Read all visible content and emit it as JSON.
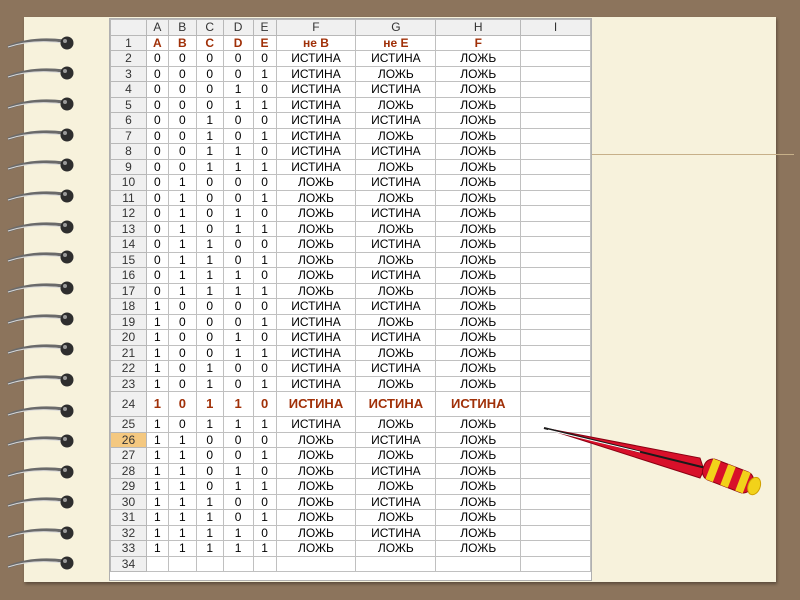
{
  "columns": [
    "",
    "A",
    "B",
    "C",
    "D",
    "E",
    "F",
    "G",
    "H",
    "I"
  ],
  "active_row": "26",
  "highlight_row": "24",
  "header_row": "1",
  "rows": [
    [
      "1",
      "A",
      "B",
      "C",
      "D",
      "E",
      "не В",
      "не Е",
      "F",
      ""
    ],
    [
      "2",
      "0",
      "0",
      "0",
      "0",
      "0",
      "ИСТИНА",
      "ИСТИНА",
      "ЛОЖЬ",
      ""
    ],
    [
      "3",
      "0",
      "0",
      "0",
      "0",
      "1",
      "ИСТИНА",
      "ЛОЖЬ",
      "ЛОЖЬ",
      ""
    ],
    [
      "4",
      "0",
      "0",
      "0",
      "1",
      "0",
      "ИСТИНА",
      "ИСТИНА",
      "ЛОЖЬ",
      ""
    ],
    [
      "5",
      "0",
      "0",
      "0",
      "1",
      "1",
      "ИСТИНА",
      "ЛОЖЬ",
      "ЛОЖЬ",
      ""
    ],
    [
      "6",
      "0",
      "0",
      "1",
      "0",
      "0",
      "ИСТИНА",
      "ИСТИНА",
      "ЛОЖЬ",
      ""
    ],
    [
      "7",
      "0",
      "0",
      "1",
      "0",
      "1",
      "ИСТИНА",
      "ЛОЖЬ",
      "ЛОЖЬ",
      ""
    ],
    [
      "8",
      "0",
      "0",
      "1",
      "1",
      "0",
      "ИСТИНА",
      "ИСТИНА",
      "ЛОЖЬ",
      ""
    ],
    [
      "9",
      "0",
      "0",
      "1",
      "1",
      "1",
      "ИСТИНА",
      "ЛОЖЬ",
      "ЛОЖЬ",
      ""
    ],
    [
      "10",
      "0",
      "1",
      "0",
      "0",
      "0",
      "ЛОЖЬ",
      "ИСТИНА",
      "ЛОЖЬ",
      ""
    ],
    [
      "11",
      "0",
      "1",
      "0",
      "0",
      "1",
      "ЛОЖЬ",
      "ЛОЖЬ",
      "ЛОЖЬ",
      ""
    ],
    [
      "12",
      "0",
      "1",
      "0",
      "1",
      "0",
      "ЛОЖЬ",
      "ИСТИНА",
      "ЛОЖЬ",
      ""
    ],
    [
      "13",
      "0",
      "1",
      "0",
      "1",
      "1",
      "ЛОЖЬ",
      "ЛОЖЬ",
      "ЛОЖЬ",
      ""
    ],
    [
      "14",
      "0",
      "1",
      "1",
      "0",
      "0",
      "ЛОЖЬ",
      "ИСТИНА",
      "ЛОЖЬ",
      ""
    ],
    [
      "15",
      "0",
      "1",
      "1",
      "0",
      "1",
      "ЛОЖЬ",
      "ЛОЖЬ",
      "ЛОЖЬ",
      ""
    ],
    [
      "16",
      "0",
      "1",
      "1",
      "1",
      "0",
      "ЛОЖЬ",
      "ИСТИНА",
      "ЛОЖЬ",
      ""
    ],
    [
      "17",
      "0",
      "1",
      "1",
      "1",
      "1",
      "ЛОЖЬ",
      "ЛОЖЬ",
      "ЛОЖЬ",
      ""
    ],
    [
      "18",
      "1",
      "0",
      "0",
      "0",
      "0",
      "ИСТИНА",
      "ИСТИНА",
      "ЛОЖЬ",
      ""
    ],
    [
      "19",
      "1",
      "0",
      "0",
      "0",
      "1",
      "ИСТИНА",
      "ЛОЖЬ",
      "ЛОЖЬ",
      ""
    ],
    [
      "20",
      "1",
      "0",
      "0",
      "1",
      "0",
      "ИСТИНА",
      "ИСТИНА",
      "ЛОЖЬ",
      ""
    ],
    [
      "21",
      "1",
      "0",
      "0",
      "1",
      "1",
      "ИСТИНА",
      "ЛОЖЬ",
      "ЛОЖЬ",
      ""
    ],
    [
      "22",
      "1",
      "0",
      "1",
      "0",
      "0",
      "ИСТИНА",
      "ИСТИНА",
      "ЛОЖЬ",
      ""
    ],
    [
      "23",
      "1",
      "0",
      "1",
      "0",
      "1",
      "ИСТИНА",
      "ЛОЖЬ",
      "ЛОЖЬ",
      ""
    ],
    [
      "24",
      "1",
      "0",
      "1",
      "1",
      "0",
      "ИСТИНА",
      "ИСТИНА",
      "ИСТИНА",
      ""
    ],
    [
      "25",
      "1",
      "0",
      "1",
      "1",
      "1",
      "ИСТИНА",
      "ЛОЖЬ",
      "ЛОЖЬ",
      ""
    ],
    [
      "26",
      "1",
      "1",
      "0",
      "0",
      "0",
      "ЛОЖЬ",
      "ИСТИНА",
      "ЛОЖЬ",
      ""
    ],
    [
      "27",
      "1",
      "1",
      "0",
      "0",
      "1",
      "ЛОЖЬ",
      "ЛОЖЬ",
      "ЛОЖЬ",
      ""
    ],
    [
      "28",
      "1",
      "1",
      "0",
      "1",
      "0",
      "ЛОЖЬ",
      "ИСТИНА",
      "ЛОЖЬ",
      ""
    ],
    [
      "29",
      "1",
      "1",
      "0",
      "1",
      "1",
      "ЛОЖЬ",
      "ЛОЖЬ",
      "ЛОЖЬ",
      ""
    ],
    [
      "30",
      "1",
      "1",
      "1",
      "0",
      "0",
      "ЛОЖЬ",
      "ИСТИНА",
      "ЛОЖЬ",
      ""
    ],
    [
      "31",
      "1",
      "1",
      "1",
      "0",
      "1",
      "ЛОЖЬ",
      "ЛОЖЬ",
      "ЛОЖЬ",
      ""
    ],
    [
      "32",
      "1",
      "1",
      "1",
      "1",
      "0",
      "ЛОЖЬ",
      "ИСТИНА",
      "ЛОЖЬ",
      ""
    ],
    [
      "33",
      "1",
      "1",
      "1",
      "1",
      "1",
      "ЛОЖЬ",
      "ЛОЖЬ",
      "ЛОЖЬ",
      ""
    ],
    [
      "34",
      "",
      "",
      "",
      "",
      "",
      "",
      "",
      "",
      ""
    ]
  ],
  "icons": {
    "binding": "spiral-ring-icon",
    "pointer": "pencil-pointer-icon"
  },
  "colors": {
    "background": "#8c745c",
    "paper": "#f7f2dc",
    "emphasis_text": "#a03008",
    "active_row_header": "#f4c880",
    "pointer_body": "#d8102a",
    "pointer_band": "#f2d21a"
  }
}
